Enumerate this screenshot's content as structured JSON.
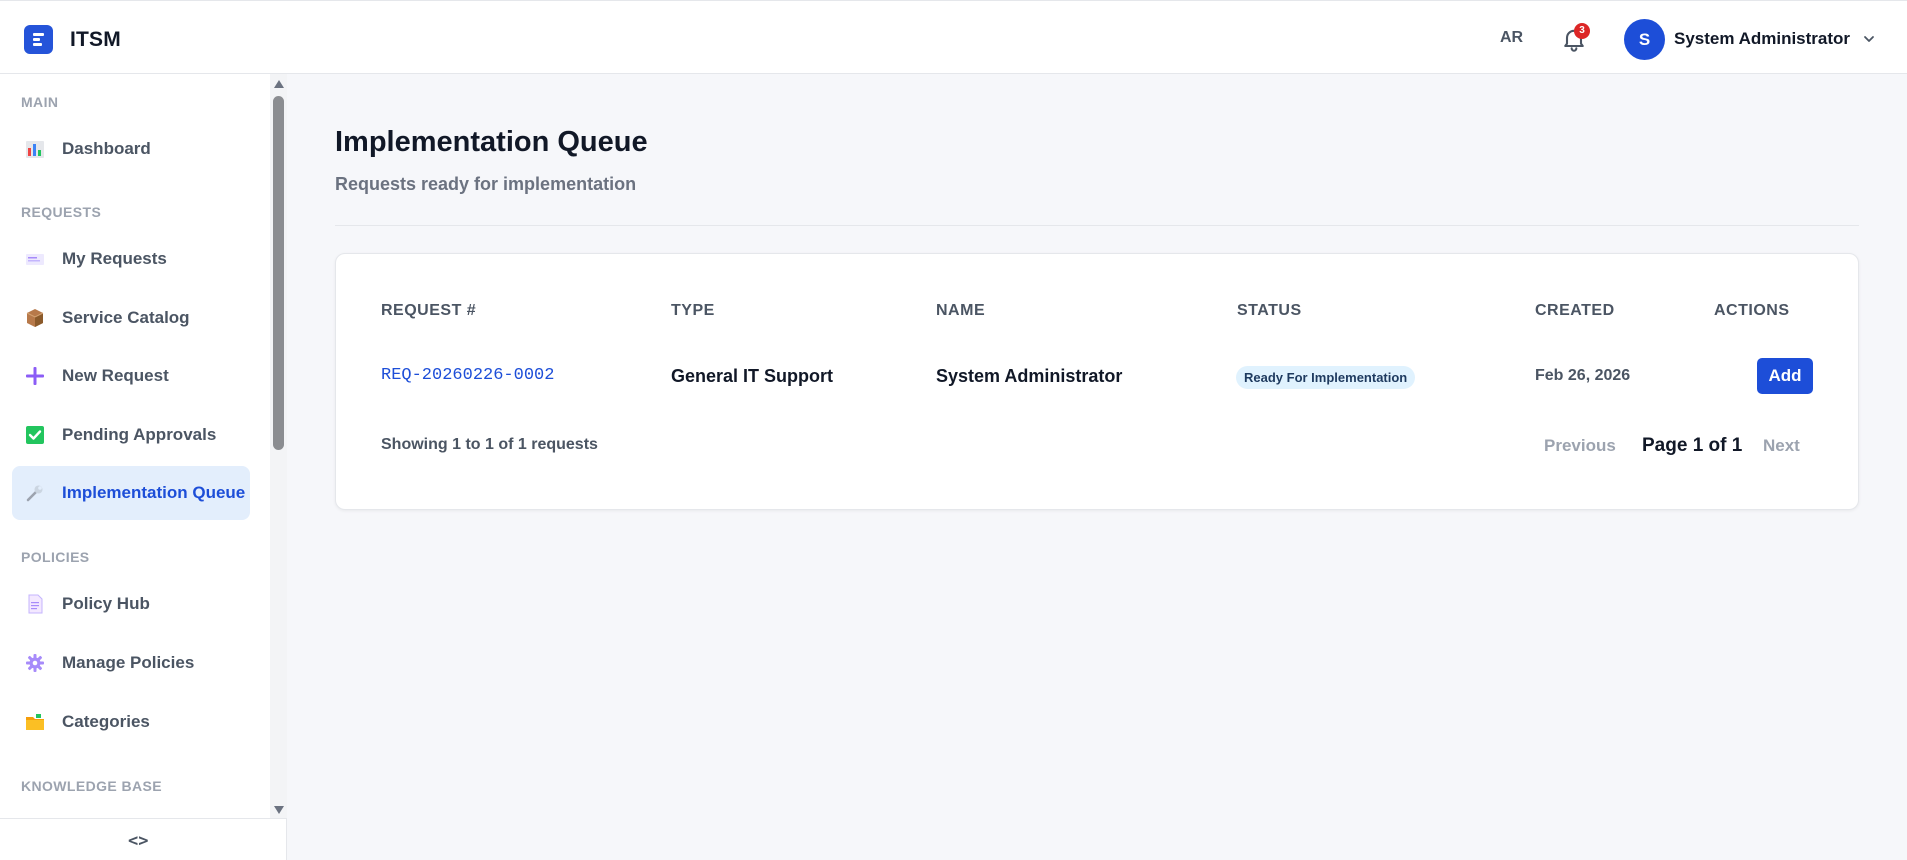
{
  "app": {
    "title": "ITSM",
    "logo_icon": "document-list-icon"
  },
  "header": {
    "language": "AR",
    "notifications": {
      "icon": "bell-icon",
      "count": "3"
    },
    "user": {
      "initial": "S",
      "name": "System Administrator"
    }
  },
  "sidebar": {
    "sections": {
      "main": "MAIN",
      "requests": "REQUESTS",
      "policies": "POLICIES",
      "knowledge_base": "KNOWLEDGE BASE"
    },
    "items": {
      "dashboard": "Dashboard",
      "my_requests": "My Requests",
      "service_catalog": "Service Catalog",
      "new_request": "New Request",
      "pending_approvals": "Pending Approvals",
      "implementation_queue": "Implementation Queue",
      "policy_hub": "Policy Hub",
      "manage_policies": "Manage Policies",
      "categories": "Categories"
    },
    "collapse_label": "<>"
  },
  "page": {
    "title": "Implementation Queue",
    "subtitle": "Requests ready for implementation"
  },
  "table": {
    "columns": {
      "request": "REQUEST #",
      "type": "TYPE",
      "name": "NAME",
      "status": "STATUS",
      "created": "CREATED",
      "actions": "ACTIONS"
    },
    "rows": [
      {
        "request": "REQ-20260226-0002",
        "type": "General IT Support",
        "name": "System Administrator",
        "status": "Ready For Implementation",
        "created": "Feb 26, 2026",
        "action": "Add"
      }
    ],
    "showing": "Showing 1 to 1 of 1 requests",
    "pagination": {
      "previous": "Previous",
      "current": "Page 1 of 1",
      "next": "Next"
    }
  },
  "colors": {
    "accent": "#1d4ed8",
    "active_nav_bg": "#e3eefc",
    "status_badge_bg": "#e0f2fe",
    "notification_badge": "#dc2626"
  }
}
